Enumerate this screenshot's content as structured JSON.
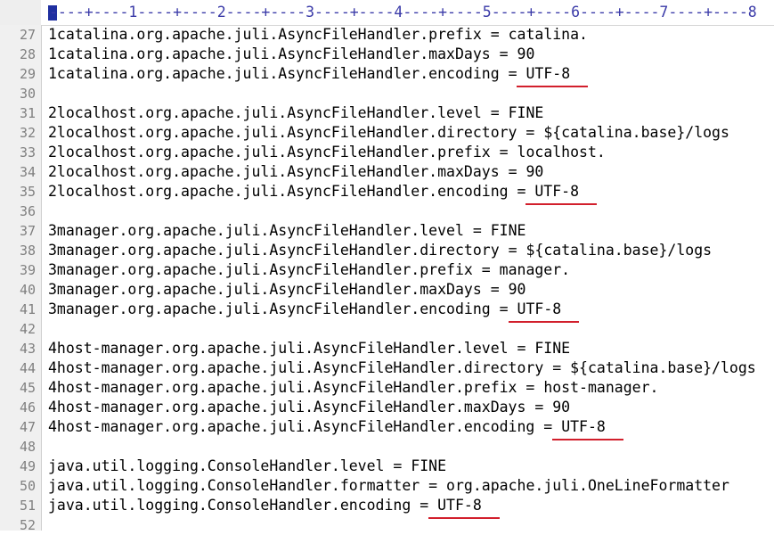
{
  "ruler": {
    "text": "----+----1----+----2----+----3----+----4----+----5----+----6----+----7----+----8"
  },
  "lines": [
    {
      "num": "27",
      "key": "1catalina.org.apache.juli.AsyncFileHandler.prefix",
      "val": "catalina.",
      "marked": false
    },
    {
      "num": "28",
      "key": "1catalina.org.apache.juli.AsyncFileHandler.maxDays",
      "val": "90",
      "marked": false
    },
    {
      "num": "29",
      "key": "1catalina.org.apache.juli.AsyncFileHandler.encoding",
      "val": "UTF-8",
      "marked": true
    },
    {
      "num": "30",
      "key": "",
      "val": "",
      "marked": false
    },
    {
      "num": "31",
      "key": "2localhost.org.apache.juli.AsyncFileHandler.level",
      "val": "FINE",
      "marked": false
    },
    {
      "num": "32",
      "key": "2localhost.org.apache.juli.AsyncFileHandler.directory",
      "val": "${catalina.base}/logs",
      "marked": false
    },
    {
      "num": "33",
      "key": "2localhost.org.apache.juli.AsyncFileHandler.prefix",
      "val": "localhost.",
      "marked": false
    },
    {
      "num": "34",
      "key": "2localhost.org.apache.juli.AsyncFileHandler.maxDays",
      "val": "90",
      "marked": false
    },
    {
      "num": "35",
      "key": "2localhost.org.apache.juli.AsyncFileHandler.encoding",
      "val": "UTF-8",
      "marked": true
    },
    {
      "num": "36",
      "key": "",
      "val": "",
      "marked": false
    },
    {
      "num": "37",
      "key": "3manager.org.apache.juli.AsyncFileHandler.level",
      "val": "FINE",
      "marked": false
    },
    {
      "num": "38",
      "key": "3manager.org.apache.juli.AsyncFileHandler.directory",
      "val": "${catalina.base}/logs",
      "marked": false
    },
    {
      "num": "39",
      "key": "3manager.org.apache.juli.AsyncFileHandler.prefix",
      "val": "manager.",
      "marked": false
    },
    {
      "num": "40",
      "key": "3manager.org.apache.juli.AsyncFileHandler.maxDays",
      "val": "90",
      "marked": false
    },
    {
      "num": "41",
      "key": "3manager.org.apache.juli.AsyncFileHandler.encoding",
      "val": "UTF-8",
      "marked": true
    },
    {
      "num": "42",
      "key": "",
      "val": "",
      "marked": false
    },
    {
      "num": "43",
      "key": "4host-manager.org.apache.juli.AsyncFileHandler.level",
      "val": "FINE",
      "marked": false
    },
    {
      "num": "44",
      "key": "4host-manager.org.apache.juli.AsyncFileHandler.directory",
      "val": "${catalina.base}/logs",
      "marked": false
    },
    {
      "num": "45",
      "key": "4host-manager.org.apache.juli.AsyncFileHandler.prefix",
      "val": "host-manager.",
      "marked": false
    },
    {
      "num": "46",
      "key": "4host-manager.org.apache.juli.AsyncFileHandler.maxDays",
      "val": "90",
      "marked": false
    },
    {
      "num": "47",
      "key": "4host-manager.org.apache.juli.AsyncFileHandler.encoding",
      "val": "UTF-8",
      "marked": true
    },
    {
      "num": "48",
      "key": "",
      "val": "",
      "marked": false
    },
    {
      "num": "49",
      "key": "java.util.logging.ConsoleHandler.level",
      "val": "FINE",
      "marked": false
    },
    {
      "num": "50",
      "key": "java.util.logging.ConsoleHandler.formatter",
      "val": "org.apache.juli.OneLineFormatter",
      "marked": false
    },
    {
      "num": "51",
      "key": "java.util.logging.ConsoleHandler.encoding",
      "val": "UTF-8",
      "marked": true
    },
    {
      "num": "52",
      "key": "",
      "val": "",
      "marked": false
    }
  ],
  "colors": {
    "underline": "#d21f2c",
    "line_numbers": "#808080",
    "ruler_text": "#3a3aa8"
  }
}
